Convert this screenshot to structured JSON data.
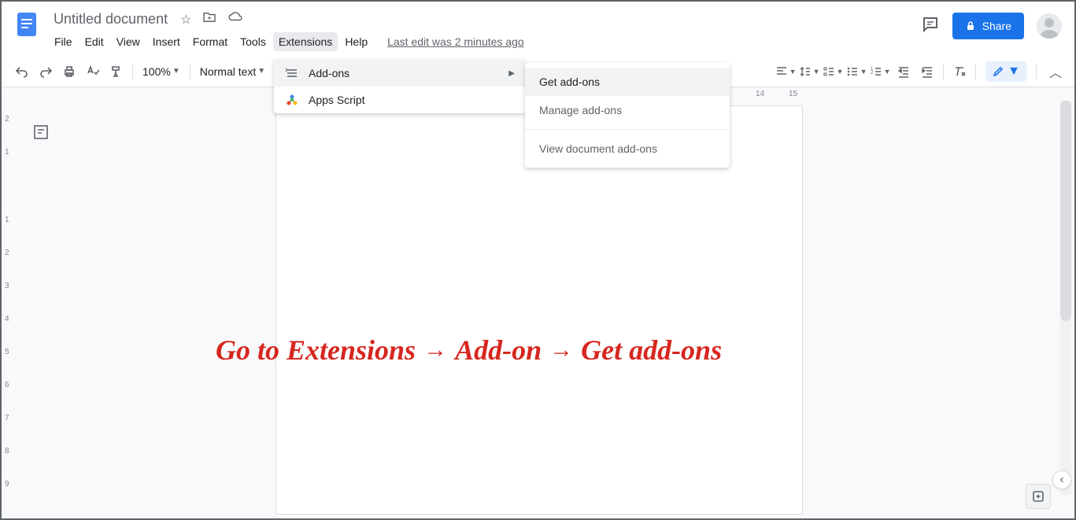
{
  "header": {
    "title": "Untitled document",
    "last_edit": "Last edit was 2 minutes ago"
  },
  "menubar": [
    "File",
    "Edit",
    "View",
    "Insert",
    "Format",
    "Tools",
    "Extensions",
    "Help"
  ],
  "active_menu_index": 6,
  "share": {
    "label": "Share"
  },
  "toolbar": {
    "zoom": "100%",
    "style": "Normal text"
  },
  "ruler_numbers": [
    "14",
    "15"
  ],
  "extensions_menu": {
    "addons": "Add-ons",
    "apps_script": "Apps Script"
  },
  "addons_submenu": {
    "get": "Get add-ons",
    "manage": "Manage add-ons",
    "view_doc": "View document add-ons"
  },
  "annotation": {
    "text1": "Go to Extensions",
    "text2": "Add-on",
    "text3": "Get add-ons"
  }
}
